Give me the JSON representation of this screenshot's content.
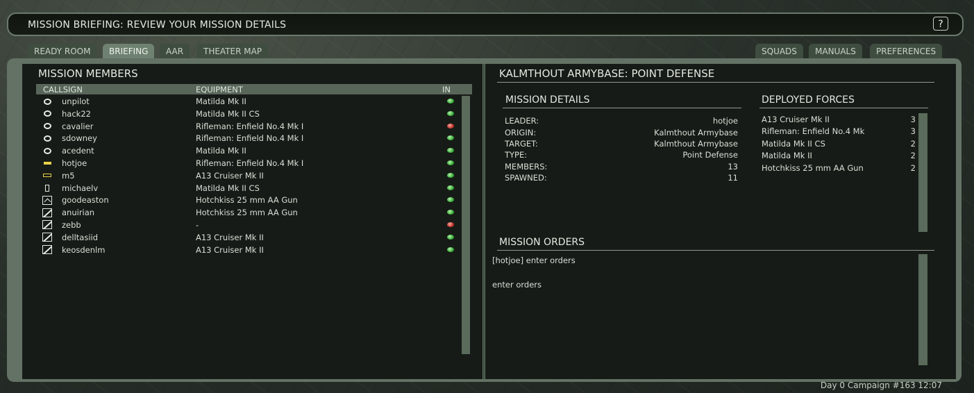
{
  "window": {
    "title": "MISSION BRIEFING: REVIEW YOUR MISSION DETAILS",
    "help_label": "?"
  },
  "tabs_left": [
    {
      "label": "READY ROOM",
      "active": false
    },
    {
      "label": "BRIEFING",
      "active": true
    },
    {
      "label": "AAR",
      "active": false
    },
    {
      "label": "THEATER MAP",
      "active": false
    }
  ],
  "tabs_right": [
    {
      "label": "SQUADS"
    },
    {
      "label": "MANUALS"
    },
    {
      "label": "PREFERENCES"
    }
  ],
  "members": {
    "title": "MISSION MEMBERS",
    "columns": {
      "callsign": "CALLSIGN",
      "equipment": "EQUIPMENT",
      "in": "IN"
    },
    "rows": [
      {
        "callsign": "unpilot",
        "equipment": "Matilda Mk II",
        "icon": "ring-icon",
        "in": "green"
      },
      {
        "callsign": "hack22",
        "equipment": "Matilda Mk II CS",
        "icon": "ring-icon",
        "in": "green"
      },
      {
        "callsign": "cavalier",
        "equipment": "Rifleman: Enfield No.4 Mk I",
        "icon": "ring-icon",
        "in": "red"
      },
      {
        "callsign": "sdowney",
        "equipment": "Rifleman: Enfield No.4 Mk I",
        "icon": "ring-icon",
        "in": "green"
      },
      {
        "callsign": "acedent",
        "equipment": "Matilda Mk II",
        "icon": "ring-icon",
        "in": "green"
      },
      {
        "callsign": "hotjoe",
        "equipment": "Rifleman: Enfield No.4 Mk I",
        "icon": "yellow-bar-icon",
        "in": "green"
      },
      {
        "callsign": "m5",
        "equipment": "A13 Cruiser Mk II",
        "icon": "yellow-outline-bar-icon",
        "in": "green"
      },
      {
        "callsign": "michaelv",
        "equipment": "Matilda Mk II CS",
        "icon": "rectangle-icon",
        "in": "green"
      },
      {
        "callsign": "goodeaston",
        "equipment": "Hotchkiss 25 mm AA Gun",
        "icon": "chevron-box-icon",
        "in": "green"
      },
      {
        "callsign": "anuirian",
        "equipment": "Hotchkiss 25 mm AA Gun",
        "icon": "diagonal-box-icon",
        "in": "green"
      },
      {
        "callsign": "zebb",
        "equipment": "-",
        "icon": "diagonal-box-icon",
        "in": "red"
      },
      {
        "callsign": "delltasiid",
        "equipment": "A13 Cruiser Mk II",
        "icon": "diagonal-box-icon",
        "in": "green"
      },
      {
        "callsign": "keosdenlm",
        "equipment": "A13 Cruiser Mk II",
        "icon": "diagonal-box-icon",
        "in": "green"
      }
    ]
  },
  "mission": {
    "title": "KALMTHOUT ARMYBASE: POINT DEFENSE",
    "details_title": "MISSION DETAILS",
    "details": [
      {
        "key": "LEADER:",
        "value": "hotjoe"
      },
      {
        "key": "ORIGIN:",
        "value": "Kalmthout Armybase"
      },
      {
        "key": "TARGET:",
        "value": "Kalmthout Armybase"
      },
      {
        "key": "TYPE:",
        "value": "Point Defense"
      },
      {
        "key": "MEMBERS:",
        "value": "13"
      },
      {
        "key": "SPAWNED:",
        "value": "11"
      }
    ],
    "forces_title": "DEPLOYED FORCES",
    "forces": [
      {
        "name": "A13 Cruiser Mk II",
        "count": "3"
      },
      {
        "name": "Rifleman: Enfield No.4 Mk",
        "count": "3"
      },
      {
        "name": "Matilda Mk II CS",
        "count": "2"
      },
      {
        "name": "Matilda Mk II",
        "count": "2"
      },
      {
        "name": "Hotchkiss 25 mm AA Gun",
        "count": "2"
      }
    ],
    "orders_title": "MISSION ORDERS",
    "orders_line1": "[hotjoe] enter orders",
    "orders_line2": "enter orders"
  },
  "footer": {
    "status": "Day 0 Campaign #163  12:07"
  }
}
